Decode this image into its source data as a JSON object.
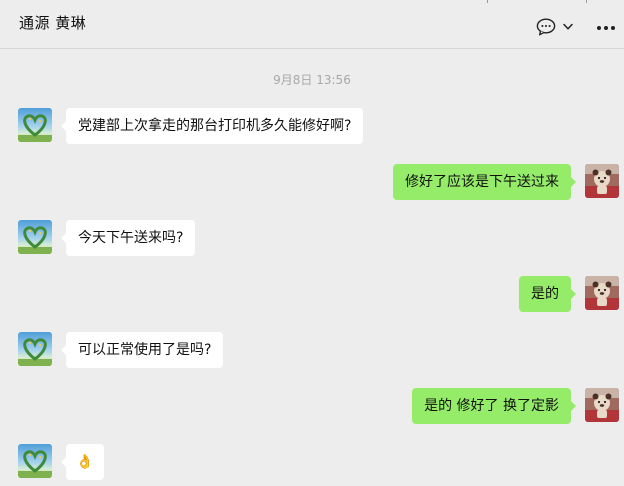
{
  "header": {
    "title": "通源 黄琳",
    "chat_icon": "chat-bubble-icon",
    "dropdown_icon": "chevron-down-icon",
    "more_icon": "more-horizontal-icon"
  },
  "chat": {
    "timestamp": "9月8日 13:56",
    "messages": [
      {
        "from": "contact",
        "text": "党建部上次拿走的那台打印机多久能修好啊?"
      },
      {
        "from": "self",
        "text": "修好了应该是下午送过来"
      },
      {
        "from": "contact",
        "text": "今天下午送来吗?"
      },
      {
        "from": "self",
        "text": "是的"
      },
      {
        "from": "contact",
        "text": "可以正常使用了是吗?"
      },
      {
        "from": "self",
        "text": "是的 修好了 换了定影"
      },
      {
        "from": "contact",
        "text": "👌"
      }
    ]
  },
  "colors": {
    "background": "#ededed",
    "incoming_bubble": "#ffffff",
    "outgoing_bubble": "#95ec69",
    "timestamp": "#a8a8a8"
  }
}
